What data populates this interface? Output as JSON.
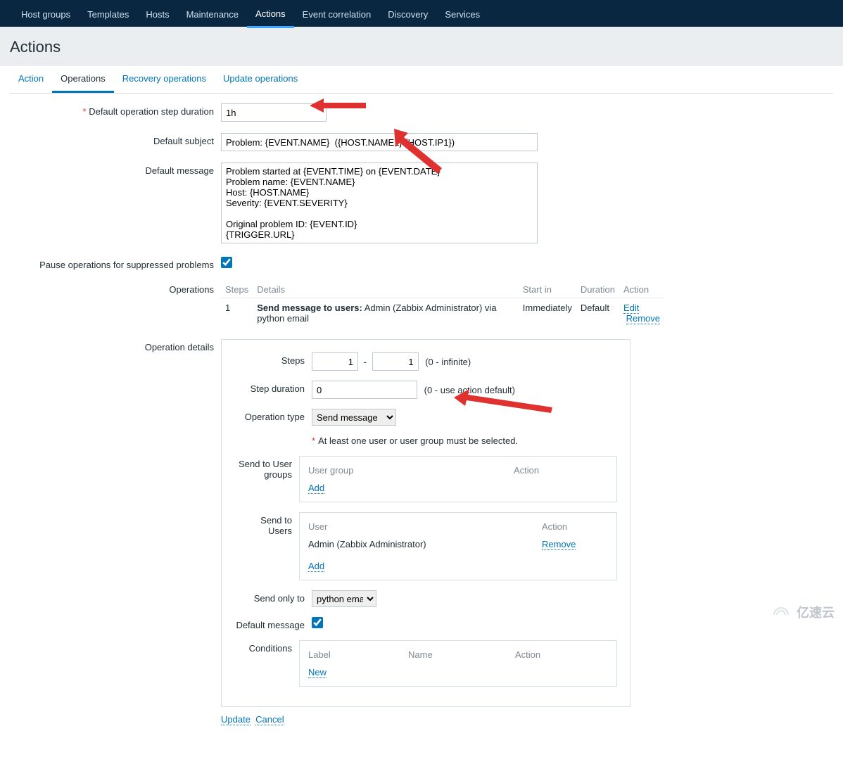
{
  "nav": {
    "items": [
      {
        "label": "Host groups"
      },
      {
        "label": "Templates"
      },
      {
        "label": "Hosts"
      },
      {
        "label": "Maintenance"
      },
      {
        "label": "Actions"
      },
      {
        "label": "Event correlation"
      },
      {
        "label": "Discovery"
      },
      {
        "label": "Services"
      }
    ],
    "activeIndex": 4
  },
  "page": {
    "title": "Actions"
  },
  "tabs": {
    "items": [
      {
        "label": "Action"
      },
      {
        "label": "Operations"
      },
      {
        "label": "Recovery operations"
      },
      {
        "label": "Update operations"
      }
    ],
    "activeIndex": 1
  },
  "form": {
    "default_step_duration_label": "Default operation step duration",
    "default_step_duration_value": "1h",
    "default_subject_label": "Default subject",
    "default_subject_value": "Problem: {EVENT.NAME}  ({HOST.NAME1} {HOST.IP1})",
    "default_message_label": "Default message",
    "default_message_value": "Problem started at {EVENT.TIME} on {EVENT.DATE}\nProblem name: {EVENT.NAME}\nHost: {HOST.NAME}\nSeverity: {EVENT.SEVERITY}\n\nOriginal problem ID: {EVENT.ID}\n{TRIGGER.URL}",
    "pause_label": "Pause operations for suppressed problems",
    "pause_checked": true,
    "operations_label": "Operations",
    "op_details_label": "Operation details"
  },
  "operations_table": {
    "headers": {
      "steps": "Steps",
      "details": "Details",
      "start_in": "Start in",
      "duration": "Duration",
      "action": "Action"
    },
    "rows": [
      {
        "steps": "1",
        "details_bold": "Send message to users:",
        "details_rest": " Admin (Zabbix Administrator) via python email",
        "start_in": "Immediately",
        "duration": "Default",
        "edit": "Edit",
        "remove": "Remove"
      }
    ]
  },
  "op_details": {
    "steps_label": "Steps",
    "steps_from": "1",
    "steps_to": "1",
    "steps_hint": "(0 - infinite)",
    "step_duration_label": "Step duration",
    "step_duration_value": "0",
    "step_duration_hint": "(0 - use action default)",
    "operation_type_label": "Operation type",
    "operation_type_value": "Send message",
    "selection_warning": "At least one user or user group must be selected.",
    "send_to_groups_label": "Send to User groups",
    "user_group_header": "User group",
    "action_header": "Action",
    "add_label": "Add",
    "send_to_users_label": "Send to Users",
    "user_header": "User",
    "user_row_name": "Admin (Zabbix Administrator)",
    "user_row_remove": "Remove",
    "send_only_to_label": "Send only to",
    "send_only_to_value": "python email",
    "default_message_label": "Default message",
    "default_message_checked": true,
    "conditions_label": "Conditions",
    "cond_label_header": "Label",
    "cond_name_header": "Name",
    "cond_action_header": "Action",
    "new_label": "New",
    "update": "Update",
    "cancel": "Cancel"
  },
  "watermark": "亿速云"
}
